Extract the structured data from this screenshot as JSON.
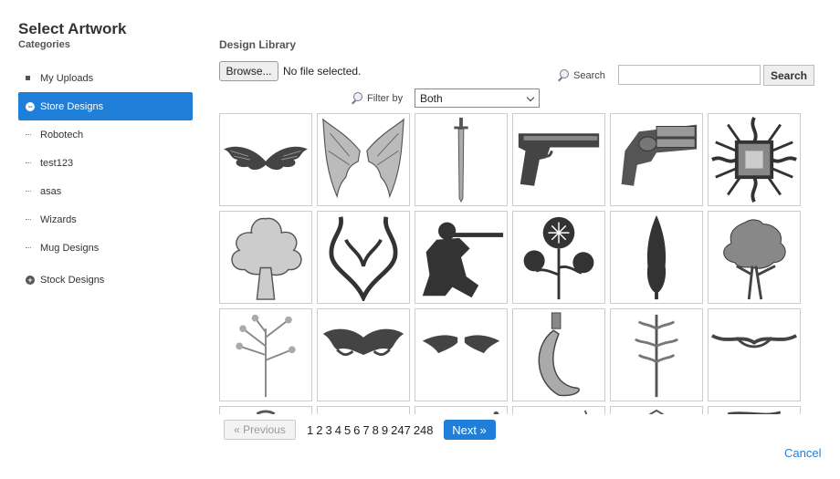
{
  "dialog": {
    "title": "Select Artwork"
  },
  "categories": {
    "heading": "Categories",
    "items": [
      {
        "label": "My Uploads",
        "marker": "square",
        "active": false
      },
      {
        "label": "Store Designs",
        "marker": "minus-circle",
        "active": true
      },
      {
        "label": "Robotech",
        "marker": "dots",
        "active": false
      },
      {
        "label": "test123",
        "marker": "dots",
        "active": false
      },
      {
        "label": "asas",
        "marker": "dots",
        "active": false
      },
      {
        "label": "Wizards",
        "marker": "dots",
        "active": false
      },
      {
        "label": "Mug Designs",
        "marker": "dots",
        "active": false
      },
      {
        "label": "Stock Designs",
        "marker": "plus-circle",
        "active": false
      }
    ]
  },
  "library": {
    "heading": "Design Library",
    "browse_label": "Browse...",
    "file_status": "No file selected.",
    "search_label": "Search",
    "search_value": "",
    "search_button": "Search",
    "filter_label": "Filter by",
    "filter_value": "Both",
    "designs": [
      "wings-dark-icon",
      "angel-wings-icon",
      "sword-icon",
      "pistol-icon",
      "revolver-icon",
      "tribal-frame-icon",
      "tree-icon",
      "tribal-heart-icon",
      "soldier-rifle-icon",
      "flower-plant-icon",
      "cypress-tree-icon",
      "oak-tree-icon",
      "sparse-tree-icon",
      "bat-wings-icon",
      "small-wings-icon",
      "sickle-icon",
      "branch-icon",
      "tribal-band-icon"
    ]
  },
  "pagination": {
    "prev_label": "« Previous",
    "pages": [
      "1",
      "2",
      "3",
      "4",
      "5",
      "6",
      "7",
      "8",
      "9",
      "247",
      "248"
    ],
    "next_label": "Next »"
  },
  "footer": {
    "cancel_label": "Cancel"
  },
  "colors": {
    "accent": "#1f7fd8",
    "art": "#444444"
  }
}
